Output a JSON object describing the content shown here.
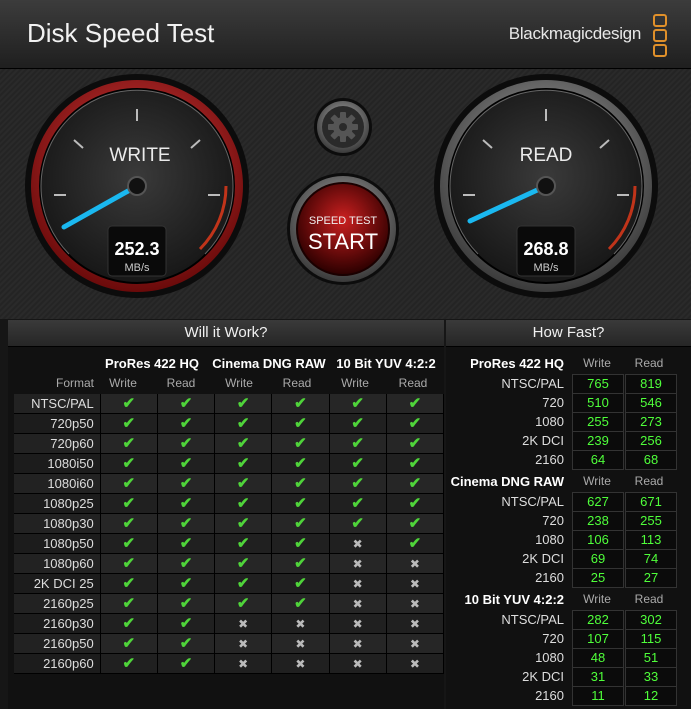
{
  "app": {
    "title": "Disk Speed Test",
    "brand": "Blackmagicdesign"
  },
  "write": {
    "label": "WRITE",
    "value": "252.3",
    "unit": "MB/s"
  },
  "read": {
    "label": "READ",
    "value": "268.8",
    "unit": "MB/s"
  },
  "start_button": {
    "top": "SPEED TEST",
    "main": "START"
  },
  "will_it_work": {
    "title": "Will it Work?",
    "groups": [
      "ProRes 422 HQ",
      "Cinema DNG RAW",
      "10 Bit YUV 4:2:2"
    ],
    "format_label": "Format",
    "write_label": "Write",
    "read_label": "Read",
    "rows": [
      {
        "format": "NTSC/PAL",
        "cells": [
          1,
          1,
          1,
          1,
          1,
          1
        ]
      },
      {
        "format": "720p50",
        "cells": [
          1,
          1,
          1,
          1,
          1,
          1
        ]
      },
      {
        "format": "720p60",
        "cells": [
          1,
          1,
          1,
          1,
          1,
          1
        ]
      },
      {
        "format": "1080i50",
        "cells": [
          1,
          1,
          1,
          1,
          1,
          1
        ]
      },
      {
        "format": "1080i60",
        "cells": [
          1,
          1,
          1,
          1,
          1,
          1
        ]
      },
      {
        "format": "1080p25",
        "cells": [
          1,
          1,
          1,
          1,
          1,
          1
        ]
      },
      {
        "format": "1080p30",
        "cells": [
          1,
          1,
          1,
          1,
          1,
          1
        ]
      },
      {
        "format": "1080p50",
        "cells": [
          1,
          1,
          1,
          1,
          0,
          1
        ]
      },
      {
        "format": "1080p60",
        "cells": [
          1,
          1,
          1,
          1,
          0,
          0
        ]
      },
      {
        "format": "2K DCI 25",
        "cells": [
          1,
          1,
          1,
          1,
          0,
          0
        ]
      },
      {
        "format": "2160p25",
        "cells": [
          1,
          1,
          1,
          1,
          0,
          0
        ]
      },
      {
        "format": "2160p30",
        "cells": [
          1,
          1,
          0,
          0,
          0,
          0
        ]
      },
      {
        "format": "2160p50",
        "cells": [
          1,
          1,
          0,
          0,
          0,
          0
        ]
      },
      {
        "format": "2160p60",
        "cells": [
          1,
          1,
          0,
          0,
          0,
          0
        ]
      }
    ]
  },
  "how_fast": {
    "title": "How Fast?",
    "write_label": "Write",
    "read_label": "Read",
    "groups": [
      {
        "name": "ProRes 422 HQ",
        "rows": [
          {
            "label": "NTSC/PAL",
            "write": "765",
            "read": "819"
          },
          {
            "label": "720",
            "write": "510",
            "read": "546"
          },
          {
            "label": "1080",
            "write": "255",
            "read": "273"
          },
          {
            "label": "2K DCI",
            "write": "239",
            "read": "256"
          },
          {
            "label": "2160",
            "write": "64",
            "read": "68"
          }
        ]
      },
      {
        "name": "Cinema DNG RAW",
        "rows": [
          {
            "label": "NTSC/PAL",
            "write": "627",
            "read": "671"
          },
          {
            "label": "720",
            "write": "238",
            "read": "255"
          },
          {
            "label": "1080",
            "write": "106",
            "read": "113"
          },
          {
            "label": "2K DCI",
            "write": "69",
            "read": "74"
          },
          {
            "label": "2160",
            "write": "25",
            "read": "27"
          }
        ]
      },
      {
        "name": "10 Bit YUV 4:2:2",
        "rows": [
          {
            "label": "NTSC/PAL",
            "write": "282",
            "read": "302"
          },
          {
            "label": "720",
            "write": "107",
            "read": "115"
          },
          {
            "label": "1080",
            "write": "48",
            "read": "51"
          },
          {
            "label": "2K DCI",
            "write": "31",
            "read": "33"
          },
          {
            "label": "2160",
            "write": "11",
            "read": "12"
          }
        ]
      }
    ]
  },
  "colors": {
    "accent_green": "#4fff3a",
    "write_ring": "#b01818",
    "needle": "#1ab8f0",
    "logo": "#e0902a"
  },
  "icons": {
    "settings": "gear-icon",
    "check": "check-icon",
    "cross": "cross-icon"
  }
}
